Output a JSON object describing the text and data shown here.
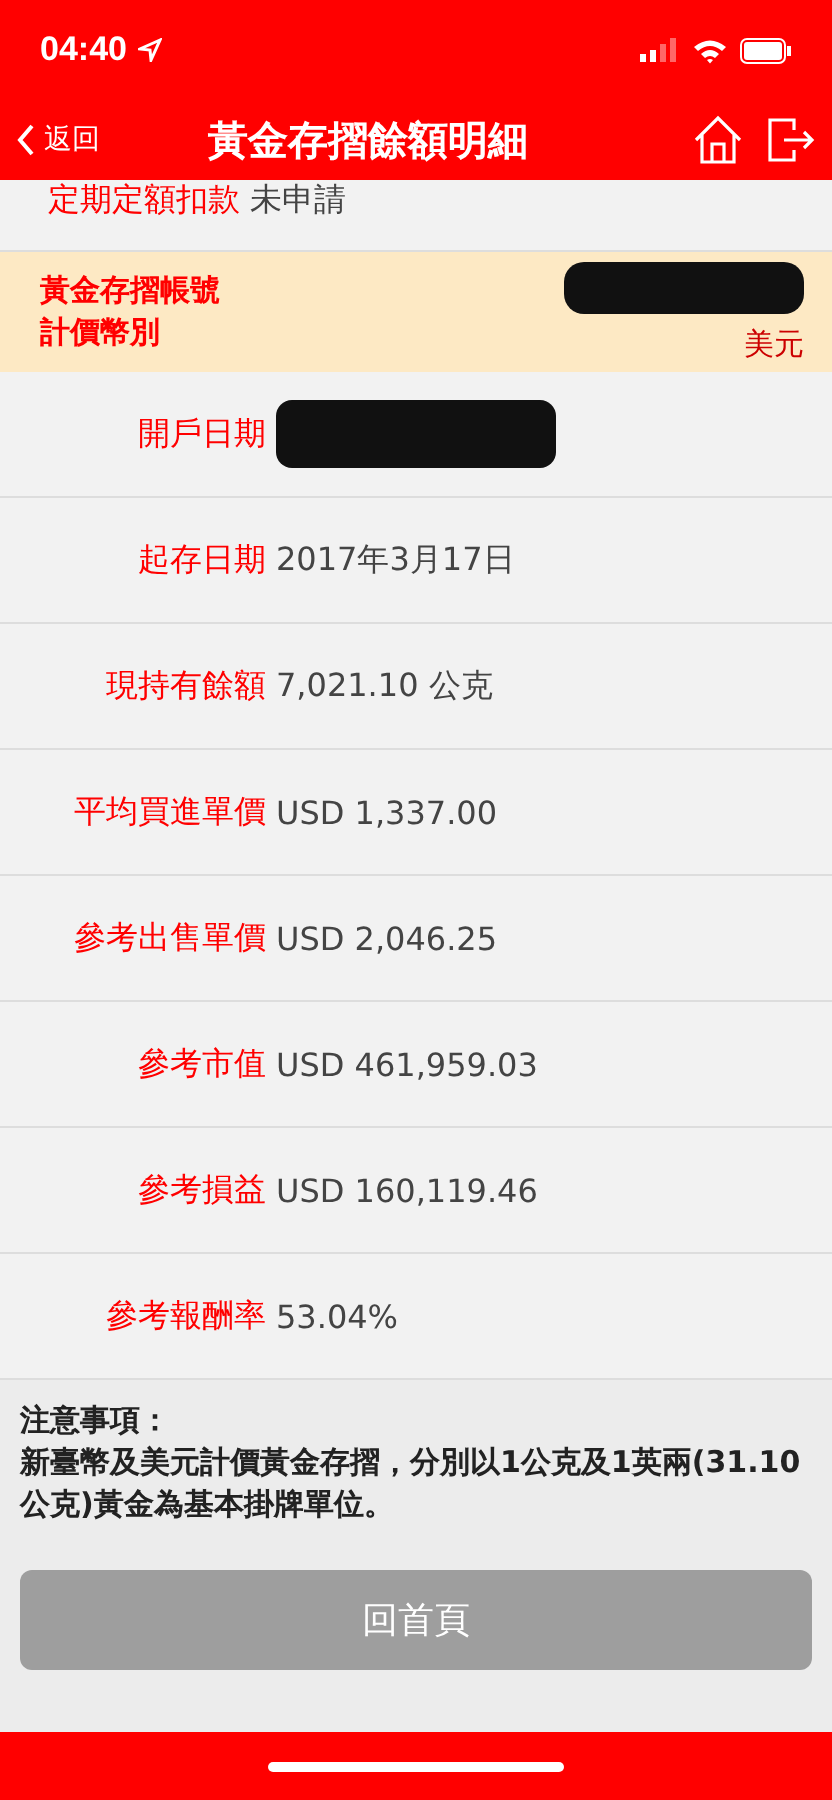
{
  "status_bar": {
    "time": "04:40"
  },
  "header": {
    "back": "返回",
    "title": "黃金存摺餘額明細"
  },
  "top_row": {
    "label": "定期定額扣款",
    "value": "未申請"
  },
  "account": {
    "labels": [
      "黃金存摺帳號",
      "計價幣別"
    ],
    "currency": "美元",
    "redacted": true
  },
  "rows": [
    {
      "label": "開戶日期",
      "value": "",
      "redacted": true
    },
    {
      "label": "起存日期",
      "value": "2017年3月17日",
      "redacted": false
    },
    {
      "label": "現持有餘額",
      "value": "7,021.10 公克",
      "redacted": false
    },
    {
      "label": "平均買進單價",
      "value": "USD 1,337.00",
      "redacted": false
    },
    {
      "label": "參考出售單價",
      "value": "USD 2,046.25",
      "redacted": false
    },
    {
      "label": "參考市值",
      "value": "USD 461,959.03",
      "redacted": false
    },
    {
      "label": "參考損益",
      "value": "USD 160,119.46",
      "redacted": false
    },
    {
      "label": "參考報酬率",
      "value": "53.04%",
      "redacted": false
    }
  ],
  "notes": {
    "title": "注意事項：",
    "text": "新臺幣及美元計價黃金存摺，分別以1公克及1英兩(31.10公克)黃金為基本掛牌單位。"
  },
  "home_button": {
    "label": "回首頁",
    "disabled": true
  }
}
